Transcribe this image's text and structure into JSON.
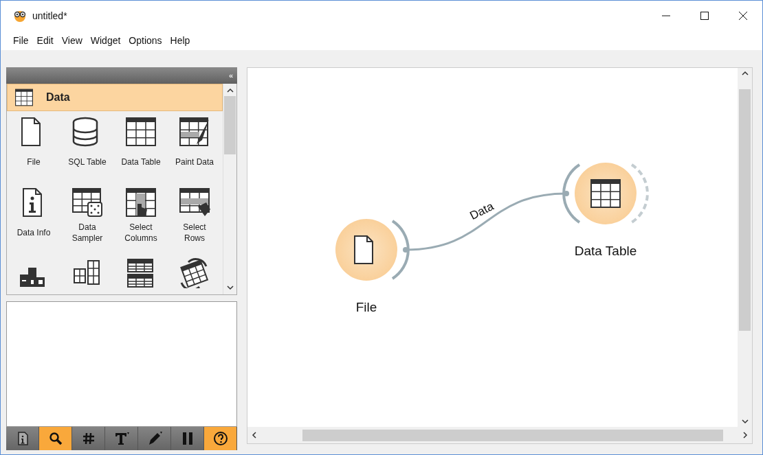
{
  "window": {
    "title": "untitled*"
  },
  "menu": [
    "File",
    "Edit",
    "View",
    "Widget",
    "Options",
    "Help"
  ],
  "toolbox": {
    "collapse_glyph": "«",
    "category": {
      "label": "Data"
    },
    "widgets": [
      {
        "label": "File",
        "kind": "file"
      },
      {
        "label": "SQL Table",
        "kind": "database"
      },
      {
        "label": "Data Table",
        "kind": "table"
      },
      {
        "label": "Paint Data",
        "kind": "paint"
      },
      {
        "label": "Data Info",
        "kind": "info"
      },
      {
        "label": "Data\nSampler",
        "kind": "sampler"
      },
      {
        "label": "Select\nColumns",
        "kind": "select-columns"
      },
      {
        "label": "Select\nRows",
        "kind": "select-rows"
      },
      {
        "kind": "rank"
      },
      {
        "kind": "merge"
      },
      {
        "kind": "concatenate"
      },
      {
        "kind": "transpose"
      }
    ]
  },
  "toolbar": [
    {
      "kind": "info",
      "selected": false
    },
    {
      "kind": "search",
      "selected": true
    },
    {
      "kind": "hash",
      "selected": false
    },
    {
      "kind": "text",
      "selected": false
    },
    {
      "kind": "pen",
      "selected": false
    },
    {
      "kind": "pause",
      "selected": false
    },
    {
      "kind": "help",
      "selected": true
    }
  ],
  "canvas": {
    "nodes": [
      {
        "label": "File",
        "kind": "file"
      },
      {
        "label": "Data Table",
        "kind": "table"
      }
    ],
    "links": [
      {
        "label": "Data"
      }
    ]
  }
}
